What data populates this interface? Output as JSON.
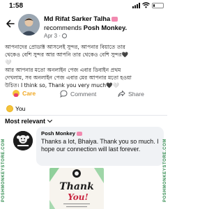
{
  "status_bar": {
    "time": "1:58",
    "battery_level": "4",
    "battery_fraction": 0.15
  },
  "post": {
    "author": "Md Rifat Sarker Talha",
    "recommends_word": "recommends",
    "page_name": "Posh Monkey.",
    "date": "Apr 3",
    "text_lines": [
      "আপনাদের প্রোডাক্ট আসলেই সুন্দর, আপনার বিয়াতে তার",
      "থেকেও বেশি সুন্দর আর আপনি তার থেকেও বেশি সুন্দর🖤",
      "🤍",
      "আর আপনার মতো অনলাইন পেজ এবার ডিবাইন প্রথম",
      "দেখলাম, সব অনলাইন পেজ এবার মের আপনার মতো হওয়া",
      "উচিত। I think so, Thank you very much🖤🤍"
    ]
  },
  "actions": {
    "care": "Care",
    "comment": "Comment",
    "share": "Share"
  },
  "reactions": {
    "label": "You"
  },
  "comments": {
    "sort_label": "Most relevant",
    "items": [
      {
        "author": "Posh Monkey",
        "text": "Thanks a lot, Bhaiya. Thank you so much. I hope our connection will last forever."
      }
    ]
  },
  "card": {
    "title_line1": "Thank",
    "title_line2": "You!"
  },
  "watermark": {
    "text": "POSHMONKEYSTORE.COM"
  },
  "colors": {
    "care_yellow": "#f0a720",
    "card_red": "#c9243f",
    "badge_pink": "#f28ab0"
  },
  "icons": [
    "back-arrow-icon",
    "globe-icon",
    "care-reaction-icon",
    "comment-icon",
    "share-icon",
    "chevron-down-icon",
    "signal-icon",
    "wifi-icon",
    "battery-icon"
  ]
}
